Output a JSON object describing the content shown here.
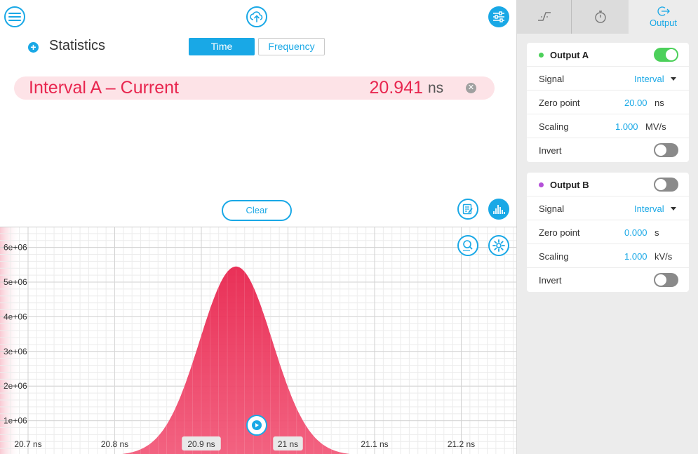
{
  "toolbar": {
    "menu_icon": "hamburger-menu-icon",
    "upload_icon": "cloud-upload-icon",
    "settings_icon": "sliders-icon"
  },
  "statistics": {
    "title": "Statistics",
    "add_icon": "plus-icon",
    "tabs": [
      "Time",
      "Frequency"
    ],
    "active_tab": "Time"
  },
  "measurement": {
    "name": "Interval A – Current",
    "value": "20.941",
    "unit": "ns",
    "color": "#e8264f"
  },
  "controls": {
    "clear_label": "Clear"
  },
  "chart_data": {
    "type": "area",
    "x_unit": "ns",
    "xlim": [
      20.69,
      21.27
    ],
    "ylim": [
      0,
      6500000
    ],
    "x_ticks": [
      "20.7 ns",
      "20.8 ns",
      "20.9 ns",
      "21 ns",
      "21.1 ns",
      "21.2 ns"
    ],
    "y_ticks": [
      "1e+06",
      "2e+06",
      "3e+06",
      "4e+06",
      "5e+06",
      "6e+06"
    ],
    "series": [
      {
        "color": "#e8264f",
        "peak_x": 20.94,
        "peak_y": 5450000,
        "x": [
          20.83,
          20.85,
          20.87,
          20.89,
          20.9,
          20.91,
          20.92,
          20.93,
          20.94,
          20.95,
          20.96,
          20.97,
          20.98,
          20.99,
          21.0,
          21.02,
          21.04,
          21.06
        ],
        "y": [
          30000,
          180000,
          700000,
          1750000,
          2500000,
          3400000,
          4300000,
          5000000,
          5450000,
          5300000,
          4750000,
          3900000,
          2900000,
          2000000,
          1250000,
          420000,
          90000,
          10000
        ]
      }
    ],
    "grid": true
  },
  "right_panel": {
    "tabs": [
      {
        "icon": "trigger-edge-icon",
        "label": ""
      },
      {
        "icon": "stopwatch-icon",
        "label": ""
      },
      {
        "icon": "output-arrow-icon",
        "label": "Output"
      }
    ],
    "output_a": {
      "title": "Output A",
      "dot_color": "#4cd05a",
      "enabled": true,
      "signal_label": "Signal",
      "signal_value": "Interval",
      "zero_label": "Zero point",
      "zero_value": "20.00",
      "zero_unit": "ns",
      "scaling_label": "Scaling",
      "scaling_value": "1.000",
      "scaling_unit": "MV/s",
      "invert_label": "Invert",
      "invert": false
    },
    "output_b": {
      "title": "Output B",
      "dot_color": "#b44fd8",
      "enabled": false,
      "signal_label": "Signal",
      "signal_value": "Interval",
      "zero_label": "Zero point",
      "zero_value": "0.000",
      "zero_unit": "s",
      "scaling_label": "Scaling",
      "scaling_value": "1.000",
      "scaling_unit": "kV/s",
      "invert_label": "Invert",
      "invert": false
    }
  }
}
